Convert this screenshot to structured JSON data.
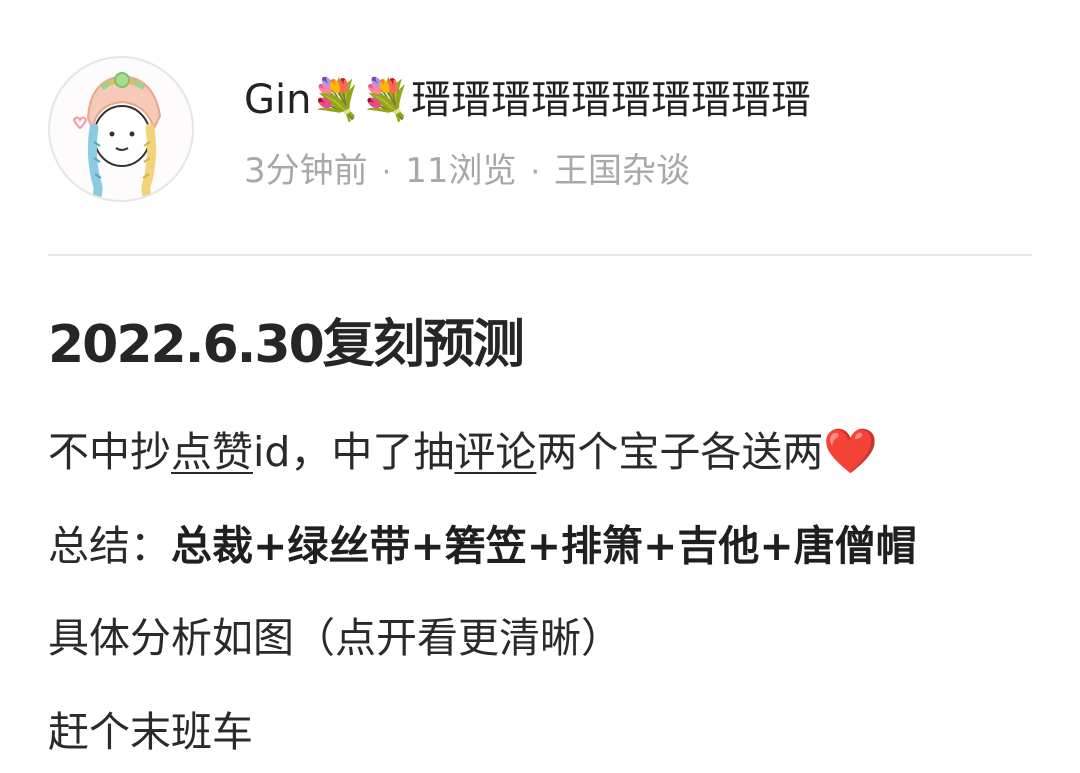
{
  "post": {
    "author_name": "Gin💐💐瑨瑨瑨瑨瑨瑨瑨瑨瑨瑨",
    "time_ago": "3分钟前",
    "views": "11浏览",
    "category": "王国杂谈",
    "separator": "·",
    "title": "2022.6.30复刻预测",
    "line1": {
      "prefix": "不中抄",
      "link1": "点赞",
      "middle": "id，中了抽",
      "link2": "评论",
      "suffix": "两个宝子各送两",
      "heart": "❤️"
    },
    "line2": {
      "label": "总结：",
      "summary": "总裁+绿丝带+箬笠+排箫+吉他+唐僧帽"
    },
    "line3": "具体分析如图（点开看更清晰）",
    "line4": "赶个末班车"
  },
  "colors": {
    "meta_text": "#a8a8a8",
    "body_text": "#2a2a2a",
    "divider": "#e8e8e8",
    "heart": "#e0242e"
  }
}
